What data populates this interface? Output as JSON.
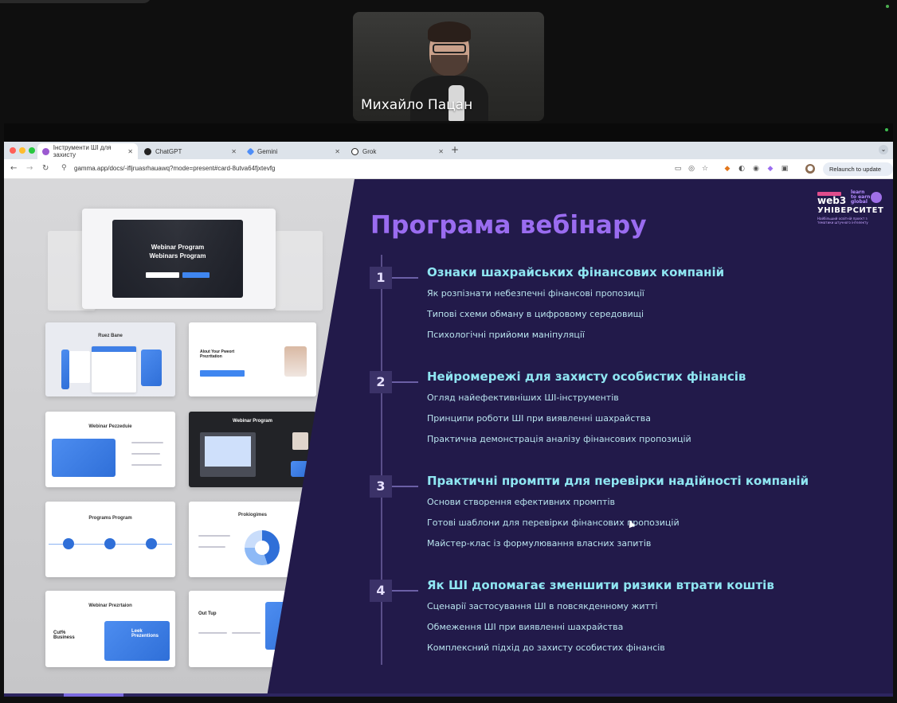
{
  "video": {
    "participant_name": "Михайло Пацан"
  },
  "browser": {
    "tabs": [
      {
        "title": "Інструменти ШІ для захисту",
        "active": true
      },
      {
        "title": "ChatGPT",
        "active": false
      },
      {
        "title": "Gemini",
        "active": false
      },
      {
        "title": "Grok",
        "active": false
      }
    ],
    "url": "gamma.app/docs/-ifljruasrhauawq?mode=present#card-8utva64fjxtevfg",
    "relaunch_label": "Relaunch to update"
  },
  "thumbnails": {
    "hero_line1": "Webinar Program",
    "hero_line2": "Webinars Program",
    "t1": "Webinar Pezzeduie",
    "t2": "Webinar Program",
    "t3": "Programs Program",
    "t4": "Prokiogimes",
    "t5": "Webinar Prezrtaion",
    "t6": "Out Tup",
    "t7": "Alout Your Pweort Prezrttation",
    "t8": "Cut% Business",
    "t9": "Leek Prezentions",
    "t10": "Ruez Bane"
  },
  "slide": {
    "title": "Програма вебінару",
    "sections": [
      {
        "number": "1",
        "title": "Ознаки шахрайських фінансових компаній",
        "bullets": [
          "Як розпізнати небезпечні фінансові пропозиції",
          "Типові схеми обману в цифровому середовищі",
          "Психологічні прийоми маніпуляції"
        ]
      },
      {
        "number": "2",
        "title": "Нейромережі для захисту особистих фінансів",
        "bullets": [
          "Огляд найефективніших ШІ-інструментів",
          "Принципи роботи ШІ при виявленні шахрайства",
          "Практична демонстрація аналізу фінансових пропозицій"
        ]
      },
      {
        "number": "3",
        "title": "Практичні промпти для перевірки надійності компаній",
        "bullets": [
          "Основи створення ефективних промптів",
          "Готові шаблони для перевірки фінансових пропозицій",
          "Майстер-клас із формулювання власних запитів"
        ]
      },
      {
        "number": "4",
        "title": "Як ШІ допомагає зменшити ризики втрати коштів",
        "bullets": [
          "Сценарії застосування ШІ в повсякденному житті",
          "Обмеження ШІ при виявленні шахрайства",
          "Комплексний підхід до захисту особистих фінансів"
        ]
      }
    ]
  },
  "logo": {
    "web3": "web3",
    "university": "УНІВЕРСИТЕТ",
    "learn": "learn\nto earn\nglobal",
    "subtitle": "Найбільший освітній проєкт з тематики штучного інтелекту"
  },
  "colors": {
    "slide_bg": "#221a4a",
    "title_purple": "#9a6cf0",
    "section_cyan": "#8fe6f2",
    "bullet_text": "#b9e4ee"
  }
}
